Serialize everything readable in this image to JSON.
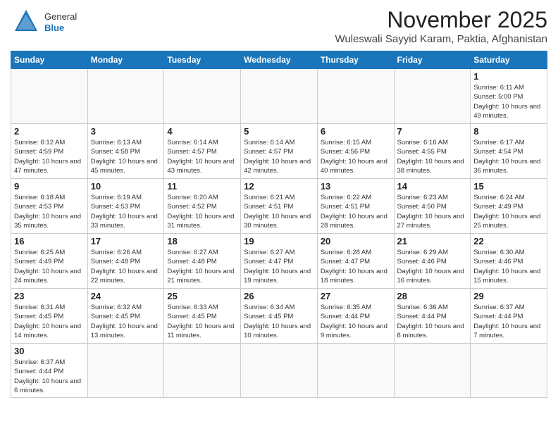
{
  "header": {
    "logo_general": "General",
    "logo_blue": "Blue",
    "month": "November 2025",
    "location": "Wuleswali Sayyid Karam, Paktia, Afghanistan"
  },
  "days_of_week": [
    "Sunday",
    "Monday",
    "Tuesday",
    "Wednesday",
    "Thursday",
    "Friday",
    "Saturday"
  ],
  "weeks": [
    [
      {
        "day": "",
        "data": ""
      },
      {
        "day": "",
        "data": ""
      },
      {
        "day": "",
        "data": ""
      },
      {
        "day": "",
        "data": ""
      },
      {
        "day": "",
        "data": ""
      },
      {
        "day": "",
        "data": ""
      },
      {
        "day": "1",
        "data": "Sunrise: 6:11 AM\nSunset: 5:00 PM\nDaylight: 10 hours and 49 minutes."
      }
    ],
    [
      {
        "day": "2",
        "data": "Sunrise: 6:12 AM\nSunset: 4:59 PM\nDaylight: 10 hours and 47 minutes."
      },
      {
        "day": "3",
        "data": "Sunrise: 6:13 AM\nSunset: 4:58 PM\nDaylight: 10 hours and 45 minutes."
      },
      {
        "day": "4",
        "data": "Sunrise: 6:14 AM\nSunset: 4:57 PM\nDaylight: 10 hours and 43 minutes."
      },
      {
        "day": "5",
        "data": "Sunrise: 6:14 AM\nSunset: 4:57 PM\nDaylight: 10 hours and 42 minutes."
      },
      {
        "day": "6",
        "data": "Sunrise: 6:15 AM\nSunset: 4:56 PM\nDaylight: 10 hours and 40 minutes."
      },
      {
        "day": "7",
        "data": "Sunrise: 6:16 AM\nSunset: 4:55 PM\nDaylight: 10 hours and 38 minutes."
      },
      {
        "day": "8",
        "data": "Sunrise: 6:17 AM\nSunset: 4:54 PM\nDaylight: 10 hours and 36 minutes."
      }
    ],
    [
      {
        "day": "9",
        "data": "Sunrise: 6:18 AM\nSunset: 4:53 PM\nDaylight: 10 hours and 35 minutes."
      },
      {
        "day": "10",
        "data": "Sunrise: 6:19 AM\nSunset: 4:53 PM\nDaylight: 10 hours and 33 minutes."
      },
      {
        "day": "11",
        "data": "Sunrise: 6:20 AM\nSunset: 4:52 PM\nDaylight: 10 hours and 31 minutes."
      },
      {
        "day": "12",
        "data": "Sunrise: 6:21 AM\nSunset: 4:51 PM\nDaylight: 10 hours and 30 minutes."
      },
      {
        "day": "13",
        "data": "Sunrise: 6:22 AM\nSunset: 4:51 PM\nDaylight: 10 hours and 28 minutes."
      },
      {
        "day": "14",
        "data": "Sunrise: 6:23 AM\nSunset: 4:50 PM\nDaylight: 10 hours and 27 minutes."
      },
      {
        "day": "15",
        "data": "Sunrise: 6:24 AM\nSunset: 4:49 PM\nDaylight: 10 hours and 25 minutes."
      }
    ],
    [
      {
        "day": "16",
        "data": "Sunrise: 6:25 AM\nSunset: 4:49 PM\nDaylight: 10 hours and 24 minutes."
      },
      {
        "day": "17",
        "data": "Sunrise: 6:26 AM\nSunset: 4:48 PM\nDaylight: 10 hours and 22 minutes."
      },
      {
        "day": "18",
        "data": "Sunrise: 6:27 AM\nSunset: 4:48 PM\nDaylight: 10 hours and 21 minutes."
      },
      {
        "day": "19",
        "data": "Sunrise: 6:27 AM\nSunset: 4:47 PM\nDaylight: 10 hours and 19 minutes."
      },
      {
        "day": "20",
        "data": "Sunrise: 6:28 AM\nSunset: 4:47 PM\nDaylight: 10 hours and 18 minutes."
      },
      {
        "day": "21",
        "data": "Sunrise: 6:29 AM\nSunset: 4:46 PM\nDaylight: 10 hours and 16 minutes."
      },
      {
        "day": "22",
        "data": "Sunrise: 6:30 AM\nSunset: 4:46 PM\nDaylight: 10 hours and 15 minutes."
      }
    ],
    [
      {
        "day": "23",
        "data": "Sunrise: 6:31 AM\nSunset: 4:45 PM\nDaylight: 10 hours and 14 minutes."
      },
      {
        "day": "24",
        "data": "Sunrise: 6:32 AM\nSunset: 4:45 PM\nDaylight: 10 hours and 13 minutes."
      },
      {
        "day": "25",
        "data": "Sunrise: 6:33 AM\nSunset: 4:45 PM\nDaylight: 10 hours and 11 minutes."
      },
      {
        "day": "26",
        "data": "Sunrise: 6:34 AM\nSunset: 4:45 PM\nDaylight: 10 hours and 10 minutes."
      },
      {
        "day": "27",
        "data": "Sunrise: 6:35 AM\nSunset: 4:44 PM\nDaylight: 10 hours and 9 minutes."
      },
      {
        "day": "28",
        "data": "Sunrise: 6:36 AM\nSunset: 4:44 PM\nDaylight: 10 hours and 8 minutes."
      },
      {
        "day": "29",
        "data": "Sunrise: 6:37 AM\nSunset: 4:44 PM\nDaylight: 10 hours and 7 minutes."
      }
    ],
    [
      {
        "day": "30",
        "data": "Sunrise: 6:37 AM\nSunset: 4:44 PM\nDaylight: 10 hours and 6 minutes."
      },
      {
        "day": "",
        "data": ""
      },
      {
        "day": "",
        "data": ""
      },
      {
        "day": "",
        "data": ""
      },
      {
        "day": "",
        "data": ""
      },
      {
        "day": "",
        "data": ""
      },
      {
        "day": "",
        "data": ""
      }
    ]
  ]
}
